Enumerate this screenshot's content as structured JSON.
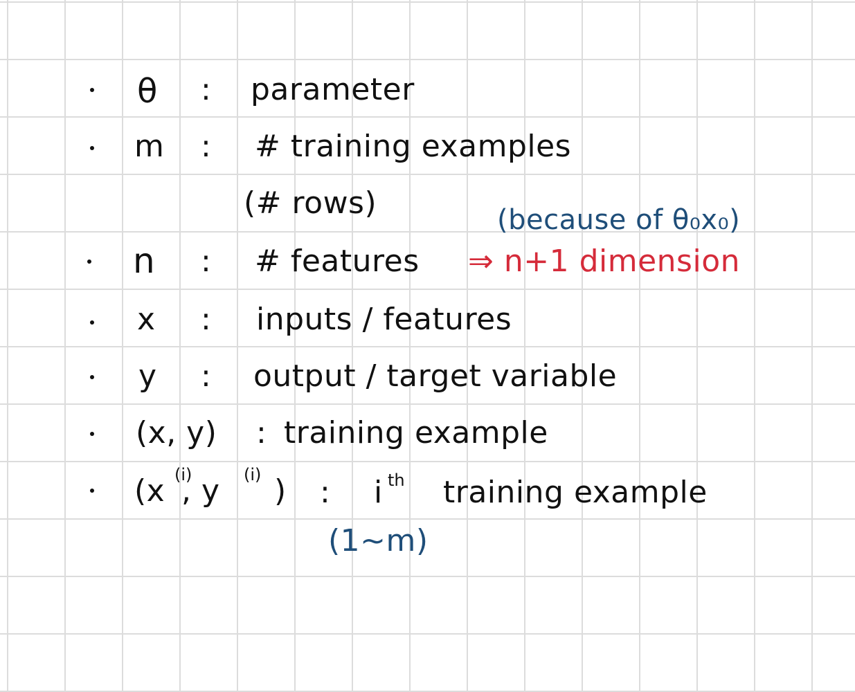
{
  "colors": {
    "ink": "#111111",
    "blue_ink": "#1f4e79",
    "red_ink": "#d52b3a",
    "grid": "#dcdcdc"
  },
  "notes": [
    {
      "symbol": "θ",
      "sep": ":",
      "desc": "parameter"
    },
    {
      "symbol": "m",
      "sep": ":",
      "desc": "# training examples",
      "desc_line2": "(# rows)"
    },
    {
      "symbol": "n",
      "sep": ":",
      "desc": "# features",
      "red_note": "⇒ n+1 dimension",
      "blue_note": "(because of θ₀x₀)"
    },
    {
      "symbol": "x",
      "sep": ":",
      "desc": "inputs / features"
    },
    {
      "symbol": "y",
      "sep": ":",
      "desc": "output / target variable"
    },
    {
      "symbol": "(x, y)",
      "sep": ":",
      "desc": "training example"
    },
    {
      "symbol_base": "(x",
      "symbol_sup": "(i)",
      "symbol_mid": ", y",
      "symbol_sup2": "(i)",
      "symbol_end": ")",
      "sep": ":",
      "desc_i": "i",
      "desc_sup": "th",
      "desc": "training example",
      "blue_note": "(1~m)"
    }
  ]
}
